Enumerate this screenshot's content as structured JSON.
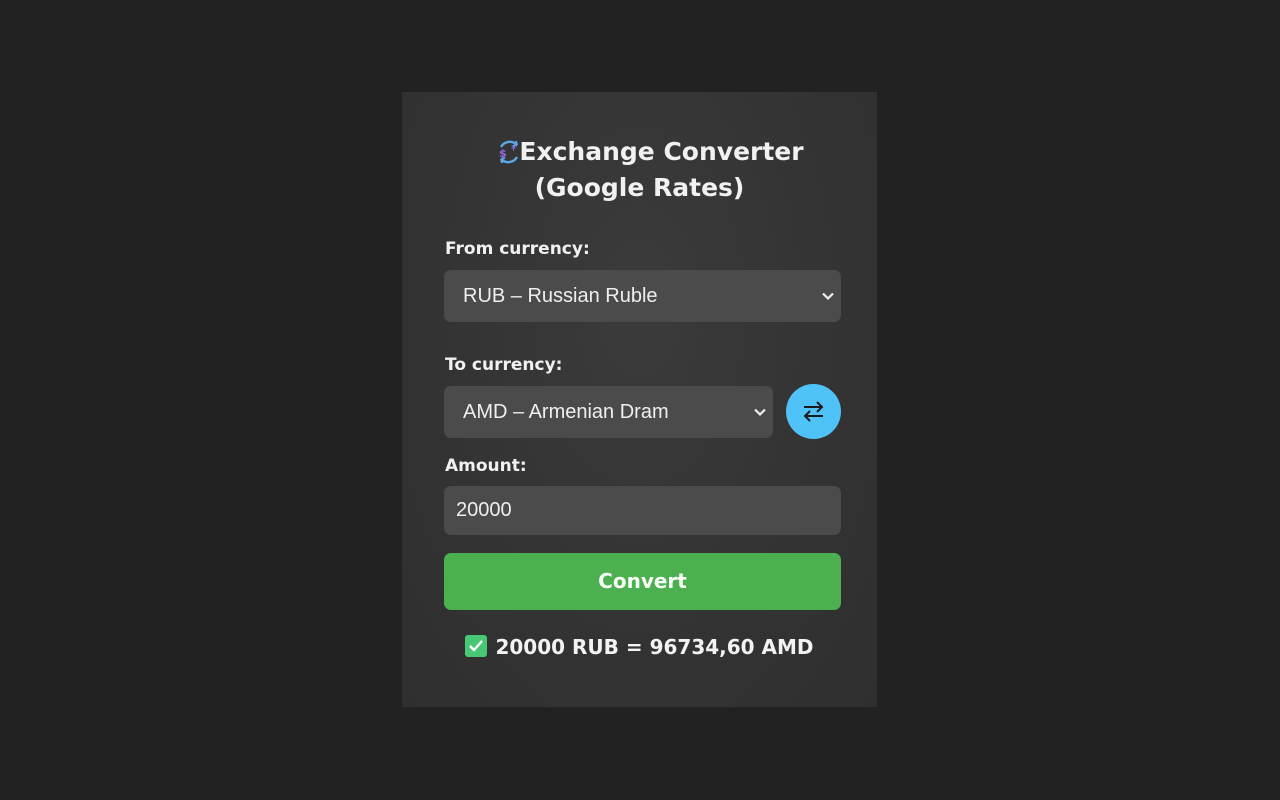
{
  "app": {
    "title_line1": "Exchange Converter",
    "title_line2": "(Google Rates)",
    "icon": "currency-exchange-icon"
  },
  "form": {
    "from_label": "From currency:",
    "from_value": "RUB – Russian Ruble",
    "to_label": "To currency:",
    "to_value": "AMD – Armenian Dram",
    "amount_label": "Amount:",
    "amount_value": "20000",
    "swap_icon": "swap-arrows-icon",
    "convert_label": "Convert"
  },
  "result": {
    "text": "20000 RUB = 96734,60 AMD",
    "icon": "check-mark-icon"
  },
  "colors": {
    "background": "#232223",
    "panel": "#353535",
    "field": "#4b4b4b",
    "accent_blue": "#4fc3f7",
    "convert_green": "#4caf50",
    "check_green": "#48c774"
  }
}
